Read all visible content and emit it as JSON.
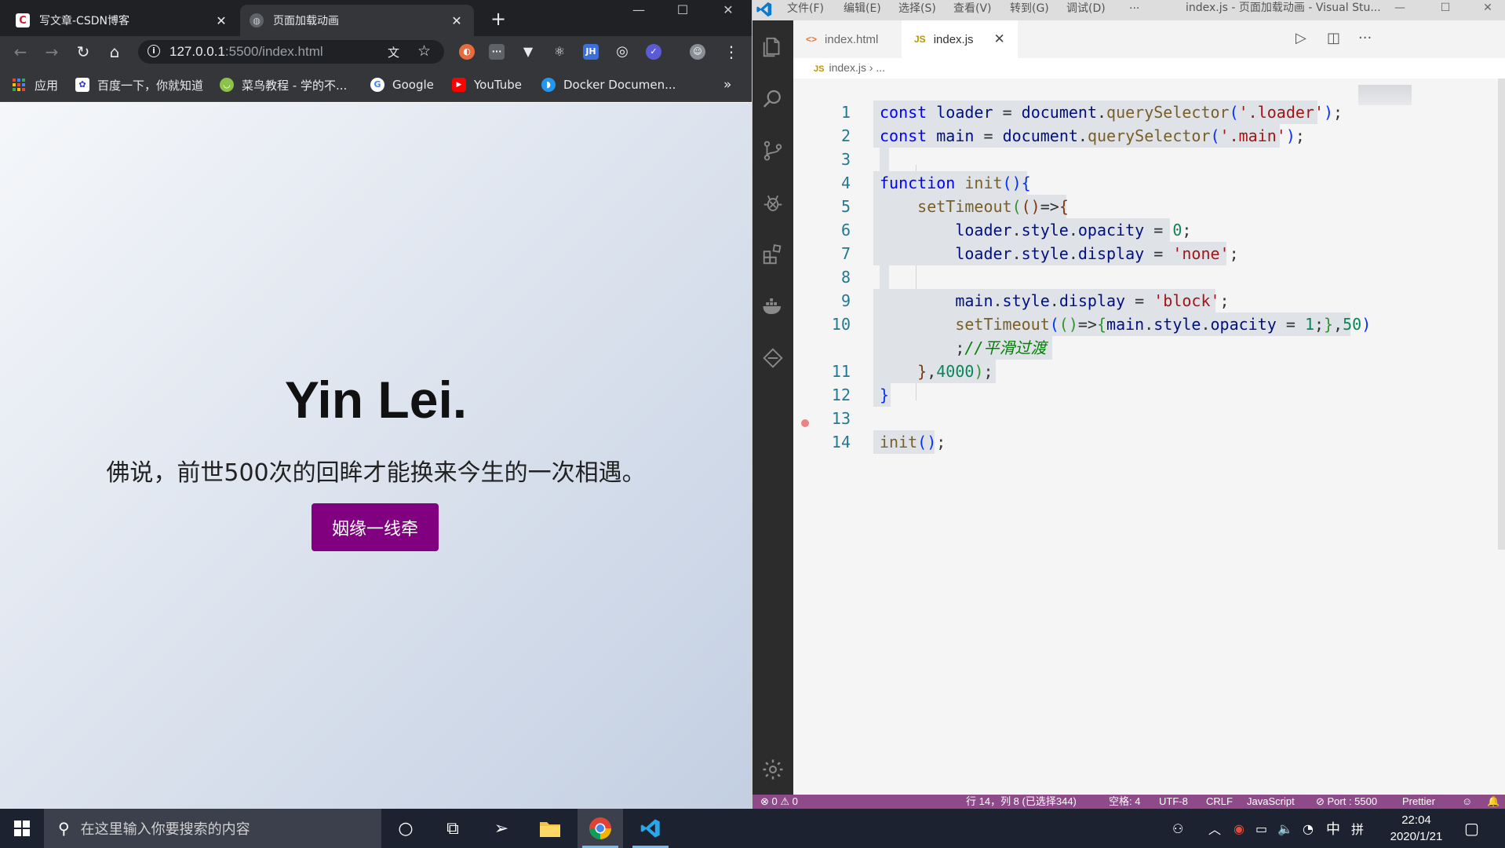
{
  "chrome": {
    "tabs": [
      {
        "title": "写文章-CSDN博客",
        "favicon": "csdn-icon",
        "active": false
      },
      {
        "title": "页面加载动画",
        "favicon": "globe-icon",
        "active": true
      }
    ],
    "new_tab": "+",
    "url_host": "127.0.0.1",
    "url_rest": ":5500/index.html",
    "bookmarks": [
      {
        "label": "应用",
        "icon": "apps-grid-icon"
      },
      {
        "label": "百度一下，你就知道",
        "icon": "baidu-icon"
      },
      {
        "label": "菜鸟教程 - 学的不...",
        "icon": "runoob-icon"
      },
      {
        "label": "Google",
        "icon": "google-icon"
      },
      {
        "label": "YouTube",
        "icon": "youtube-icon"
      },
      {
        "label": "Docker Documen...",
        "icon": "docker-icon"
      }
    ],
    "bookmarks_more": "»"
  },
  "page": {
    "title": "Yin Lei.",
    "subtitle": "佛说，前世500次的回眸才能换来今生的一次相遇。",
    "button_label": "姻缘一线牵",
    "button_color": "#800080"
  },
  "vscode": {
    "menu": [
      "文件(F)",
      "编辑(E)",
      "选择(S)",
      "查看(V)",
      "转到(G)",
      "调试(D)",
      "···"
    ],
    "window_title": "index.js - 页面加载动画 - Visual Stu...",
    "tabs": [
      {
        "label": "index.html",
        "icon": "html-file-icon",
        "active": false
      },
      {
        "label": "index.js",
        "icon": "js-file-icon",
        "active": true
      }
    ],
    "breadcrumb": {
      "file": "index.js",
      "rest": "..."
    },
    "status": {
      "errors": "⊗ 0 ⚠ 0",
      "position": "行 14，列 8 (已选择344)",
      "spaces": "空格: 4",
      "encoding": "UTF-8",
      "eol": "CRLF",
      "language": "JavaScript",
      "port": "⊘ Port : 5500",
      "formatter": "Prettier"
    },
    "accent_color": "#8f4a8a"
  },
  "taskbar": {
    "search_placeholder": "在这里输入你要搜索的内容",
    "ime": "中",
    "ime_mode": "拼",
    "time": "22:04",
    "date": "2020/1/21"
  }
}
